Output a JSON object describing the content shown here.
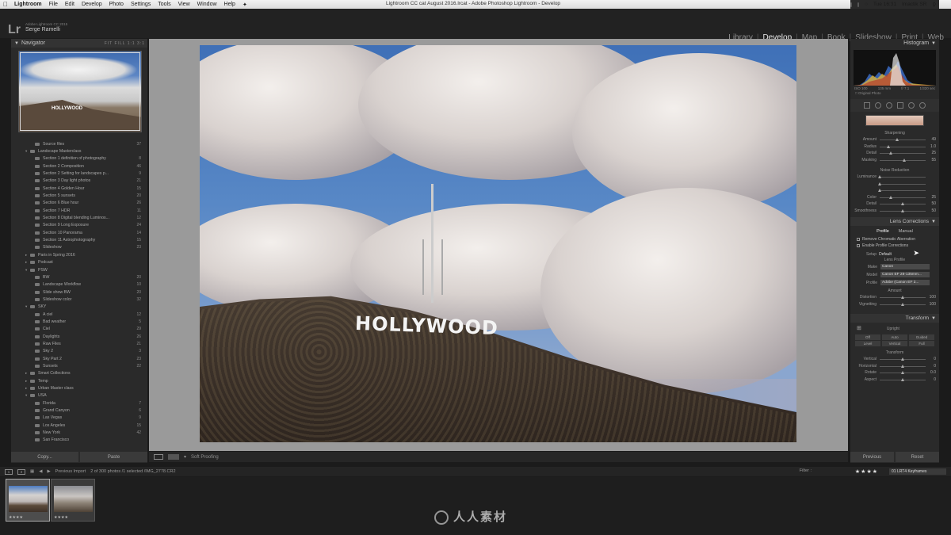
{
  "menubar": {
    "app": "Lightroom",
    "items": [
      "File",
      "Edit",
      "Develop",
      "Photo",
      "Settings",
      "Tools",
      "View",
      "Window",
      "Help"
    ],
    "window_title": "Lightroom CC cat August 2016.lrcat - Adobe Photoshop Lightroom - Develop",
    "clock": "Tue 16:31",
    "user": "Imactik SR"
  },
  "identity": {
    "logo": "Lr",
    "subtitle": "Adobe Lightroom CC 2015",
    "name": "Serge Ramelli"
  },
  "modules": [
    "Library",
    "Develop",
    "Map",
    "Book",
    "Slideshow",
    "Print",
    "Web"
  ],
  "active_module": "Develop",
  "navigator": {
    "title": "Navigator",
    "options": "FIT  FILL  1:1  3:1",
    "sign_text": "HOLLYWOOD"
  },
  "collections": [
    {
      "label": "Source files",
      "count": "37",
      "indent": 2
    },
    {
      "label": "Landscape Masterclass",
      "count": "",
      "indent": 1,
      "expanded": true
    },
    {
      "label": "Section 1 definition of photography",
      "count": "8",
      "indent": 2
    },
    {
      "label": "Section 2 Composition",
      "count": "46",
      "indent": 2
    },
    {
      "label": "Section 2 Setting for landscapes p...",
      "count": "9",
      "indent": 2
    },
    {
      "label": "Section 3 Day light photos",
      "count": "21",
      "indent": 2
    },
    {
      "label": "Section 4 Golden Hour",
      "count": "15",
      "indent": 2
    },
    {
      "label": "Section 5 sunsets",
      "count": "20",
      "indent": 2
    },
    {
      "label": "Section 6 Blue hour",
      "count": "26",
      "indent": 2
    },
    {
      "label": "Section 7 HDR",
      "count": "11",
      "indent": 2
    },
    {
      "label": "Section 8 Digital blending Luminos...",
      "count": "12",
      "indent": 2
    },
    {
      "label": "Section 9 Long Exposure",
      "count": "24",
      "indent": 2
    },
    {
      "label": "Section 10 Panorama",
      "count": "14",
      "indent": 2
    },
    {
      "label": "Section 11 Astrophotography",
      "count": "15",
      "indent": 2
    },
    {
      "label": "Slideshow",
      "count": "23",
      "indent": 2
    },
    {
      "label": "Paris in Spring 2016",
      "count": "",
      "indent": 1
    },
    {
      "label": "Podcast",
      "count": "",
      "indent": 1
    },
    {
      "label": "PSW",
      "count": "",
      "indent": 1,
      "expanded": true
    },
    {
      "label": "BW",
      "count": "20",
      "indent": 2
    },
    {
      "label": "Landscape Workflow",
      "count": "10",
      "indent": 2
    },
    {
      "label": "Slide show BW",
      "count": "20",
      "indent": 2
    },
    {
      "label": "Slideshow color",
      "count": "32",
      "indent": 2
    },
    {
      "label": "SKY",
      "count": "",
      "indent": 1,
      "expanded": true
    },
    {
      "label": "A ciel",
      "count": "12",
      "indent": 2
    },
    {
      "label": "Bad weather",
      "count": "5",
      "indent": 2
    },
    {
      "label": "Ciel",
      "count": "29",
      "indent": 2
    },
    {
      "label": "Daylights",
      "count": "26",
      "indent": 2
    },
    {
      "label": "Raw Files",
      "count": "21",
      "indent": 2
    },
    {
      "label": "Sky 2",
      "count": "3",
      "indent": 2
    },
    {
      "label": "Sky Part 2",
      "count": "23",
      "indent": 2
    },
    {
      "label": "Sunsets",
      "count": "22",
      "indent": 2
    },
    {
      "label": "Smart Collections",
      "count": "",
      "indent": 1
    },
    {
      "label": "Temp",
      "count": "",
      "indent": 1
    },
    {
      "label": "Urban Master class",
      "count": "",
      "indent": 1
    },
    {
      "label": "USA",
      "count": "",
      "indent": 1,
      "expanded": true
    },
    {
      "label": "Florida",
      "count": "7",
      "indent": 2
    },
    {
      "label": "Grand Canyon",
      "count": "6",
      "indent": 2
    },
    {
      "label": "Las Vegas",
      "count": "9",
      "indent": 2
    },
    {
      "label": "Los Angeles",
      "count": "15",
      "indent": 2
    },
    {
      "label": "New York",
      "count": "42",
      "indent": 2
    },
    {
      "label": "San Francisco",
      "count": "",
      "indent": 2
    }
  ],
  "left_footer": {
    "copy": "Copy...",
    "paste": "Paste"
  },
  "photo": {
    "sign": "HOLLYWOOD"
  },
  "toolbar": {
    "soft_proofing": "Soft Proofing"
  },
  "histogram": {
    "title": "Histogram",
    "iso": "ISO 100",
    "focal": "135 mm",
    "aperture": "f/ 7.1",
    "shutter": "1/320 sec",
    "original_photo": "Original Photo"
  },
  "detail": {
    "sharpening_title": "Sharpening",
    "sharpening": [
      {
        "label": "Amount",
        "value": "49",
        "pos": 0.38
      },
      {
        "label": "Radius",
        "value": "1.0",
        "pos": 0.2
      },
      {
        "label": "Detail",
        "value": "25",
        "pos": 0.25
      },
      {
        "label": "Masking",
        "value": "55",
        "pos": 0.55
      }
    ],
    "noise_title": "Noise Reduction",
    "noise": [
      {
        "label": "Luminance",
        "value": "",
        "pos": 0.0
      },
      {
        "label": "",
        "value": "",
        "pos": 0.0
      },
      {
        "label": "",
        "value": "",
        "pos": 0.0
      },
      {
        "label": "Color",
        "value": "25",
        "pos": 0.25
      },
      {
        "label": "Detail",
        "value": "50",
        "pos": 0.5
      },
      {
        "label": "Smoothness",
        "value": "50",
        "pos": 0.5
      }
    ]
  },
  "lens": {
    "title": "Lens Corrections",
    "tabs": [
      "Profile",
      "Manual"
    ],
    "active_tab": "Profile",
    "remove_ca": "Remove Chromatic Aberration",
    "enable_profile": "Enable Profile Corrections",
    "setup_label": "Setup",
    "setup_value": "Default",
    "lens_profile_title": "Lens Profile",
    "make_label": "Make",
    "make_value": "Canon",
    "model_label": "Model",
    "model_value": "Canon EF 28-135mm...",
    "profile_label": "Profile",
    "profile_value": "Adobe (Canon EF 2...",
    "amount_title": "Amount",
    "amount": [
      {
        "label": "Distortion",
        "value": "100",
        "pos": 0.5
      },
      {
        "label": "Vignetting",
        "value": "100",
        "pos": 0.5
      }
    ]
  },
  "transform": {
    "title": "Transform",
    "upright_title": "Upright",
    "upright_buttons_1": [
      "Off",
      "Auto",
      "Guided"
    ],
    "upright_buttons_2": [
      "Level",
      "Vertical",
      "Full"
    ],
    "transform_title": "Transform",
    "sliders": [
      {
        "label": "Vertical",
        "value": "0",
        "pos": 0.5
      },
      {
        "label": "Horizontal",
        "value": "0",
        "pos": 0.5
      },
      {
        "label": "Rotate",
        "value": "0.0",
        "pos": 0.5
      },
      {
        "label": "Aspect",
        "value": "0",
        "pos": 0.5
      }
    ]
  },
  "right_footer": {
    "previous": "Previous",
    "reset": "Reset"
  },
  "filmstrip_bar": {
    "page1": "1",
    "page2": "2",
    "source": "Previous Import",
    "info": "2 of 300 photos /1 selected /IMG_2778.CR2",
    "filter": "Filter :",
    "stars": "★★★★",
    "keyframes": "01 LRT4 Keyframes"
  },
  "filmstrip": [
    {
      "stars": "★★★★",
      "selected": true
    },
    {
      "stars": "★★★★",
      "selected": false
    }
  ],
  "watermark": "人人素材",
  "colors": {
    "panel": "#2a2a2a",
    "background": "#1b1b1b",
    "canvas": "#9a9a9a",
    "active_module": "#e6e6e6"
  }
}
